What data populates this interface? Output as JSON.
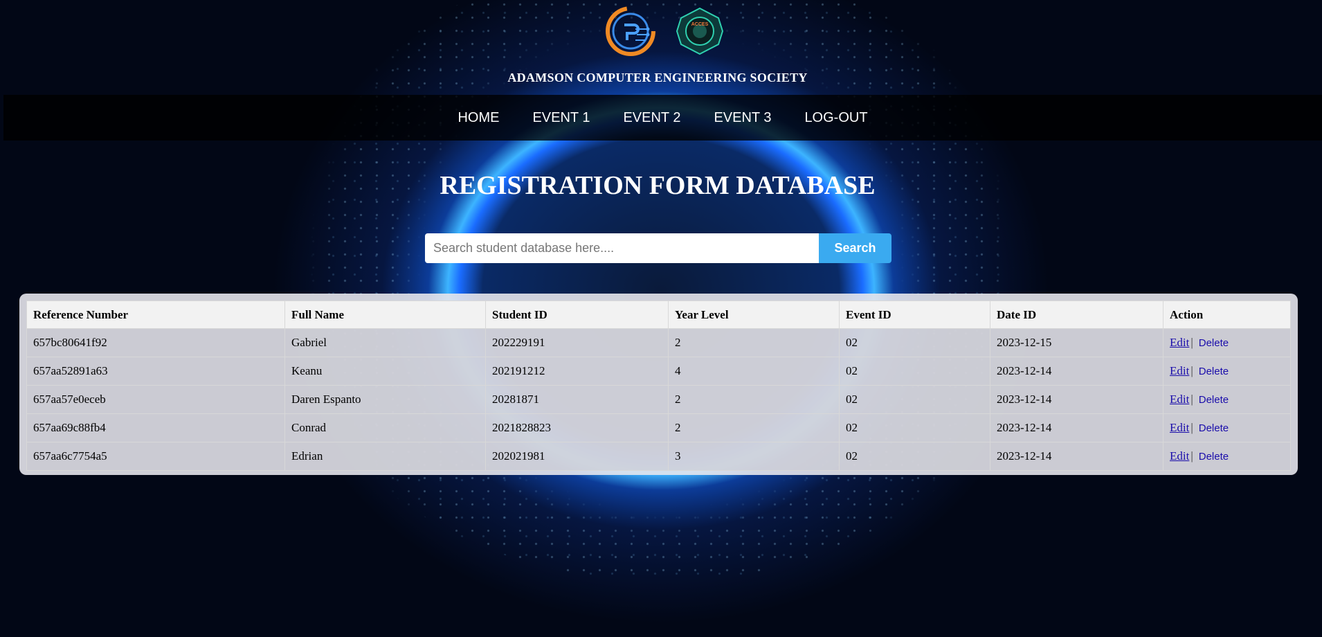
{
  "header": {
    "org_name": "ADAMSON COMPUTER ENGINEERING SOCIETY",
    "logos": [
      "cpe-logo",
      "aces-seal"
    ],
    "seal_text": "ACCES"
  },
  "nav": {
    "items": [
      {
        "label": "HOME"
      },
      {
        "label": "EVENT 1"
      },
      {
        "label": "EVENT 2"
      },
      {
        "label": "EVENT 3"
      },
      {
        "label": "LOG-OUT"
      }
    ]
  },
  "main": {
    "title": "REGISTRATION FORM DATABASE"
  },
  "search": {
    "placeholder": "Search student database here....",
    "value": "",
    "button_label": "Search"
  },
  "table": {
    "headers": [
      "Reference Number",
      "Full Name",
      "Student ID",
      "Year Level",
      "Event ID",
      "Date ID",
      "Action"
    ],
    "rows": [
      {
        "ref": "657bc80641f92",
        "name": "Gabriel",
        "student_id": "202229191",
        "year": "2",
        "event_id": "02",
        "date": "2023-12-15",
        "edit": "Edit",
        "sep": "|",
        "delete": "Delete"
      },
      {
        "ref": "657aa52891a63",
        "name": "Keanu",
        "student_id": "202191212",
        "year": "4",
        "event_id": "02",
        "date": "2023-12-14",
        "edit": "Edit",
        "sep": "|",
        "delete": "Delete"
      },
      {
        "ref": "657aa57e0eceb",
        "name": "Daren Espanto",
        "student_id": "20281871",
        "year": "2",
        "event_id": "02",
        "date": "2023-12-14",
        "edit": "Edit",
        "sep": "|",
        "delete": "Delete"
      },
      {
        "ref": "657aa69c88fb4",
        "name": "Conrad",
        "student_id": "2021828823",
        "year": "2",
        "event_id": "02",
        "date": "2023-12-14",
        "edit": "Edit",
        "sep": "|",
        "delete": "Delete"
      },
      {
        "ref": "657aa6c7754a5",
        "name": "Edrian",
        "student_id": "202021981",
        "year": "3",
        "event_id": "02",
        "date": "2023-12-14",
        "edit": "Edit",
        "sep": "|",
        "delete": "Delete"
      }
    ]
  },
  "colors": {
    "accent": "#3aaaf0",
    "link": "#1a0dab",
    "background": "#020716",
    "orb_glow": "#3db4ff"
  }
}
